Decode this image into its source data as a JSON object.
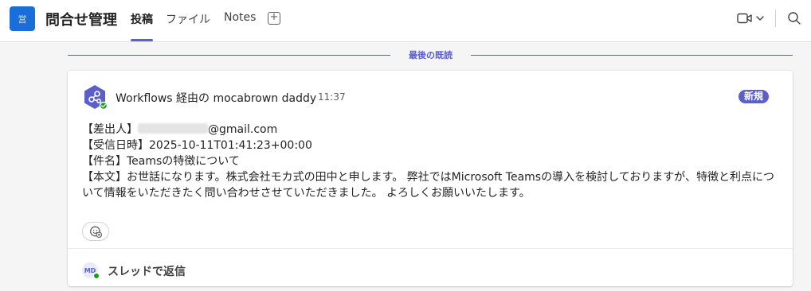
{
  "header": {
    "app_icon_glyph": "営",
    "channel_title": "問合せ管理",
    "tabs": [
      {
        "label": "投稿",
        "active": true
      },
      {
        "label": "ファイル",
        "active": false
      },
      {
        "label": "Notes",
        "active": false
      }
    ],
    "add_tab_glyph": "+",
    "icons": [
      "video-icon",
      "chevron-down-icon",
      "search-icon"
    ]
  },
  "last_read": {
    "label": "最後の既読"
  },
  "message": {
    "sender": "Workflows 経由の mocabrown daddy",
    "time": "11:37",
    "badge": "新規",
    "avatar_icon": "workflows-icon",
    "lines": {
      "sender_label": "【差出人】",
      "sender_email_suffix": "@gmail.com",
      "received": "【受信日時】2025-10-11T01:41:23+00:00",
      "subject": "【件名】Teamsの特徴について",
      "body_1": "【本文】お世話になります。株式会社モカ式の田中と申します。 弊社ではMicrosoft Teamsの導入を検討しておりますが、特徴と利点につ",
      "body_2": "いて情報をいただきたく問い合わせさせていただきました。 よろしくお願いいたします。"
    }
  },
  "reply": {
    "avatar_initials": "MD",
    "label": "スレッドで返信"
  },
  "colors": {
    "accent": "#5b5fc7",
    "app_icon": "#1a6ed8",
    "online": "#13a10e"
  }
}
